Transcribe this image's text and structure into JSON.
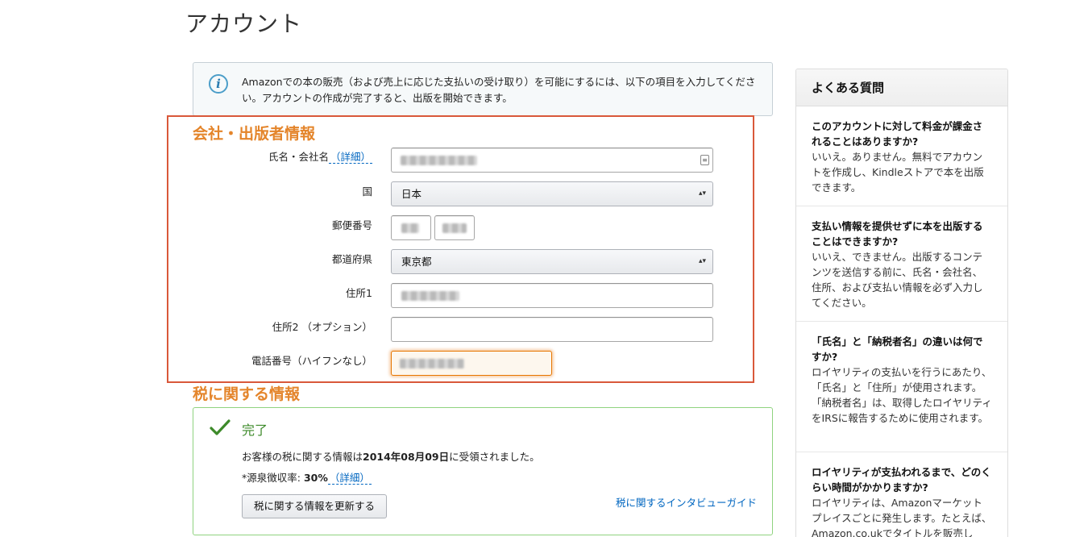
{
  "page": {
    "title": "アカウント"
  },
  "info": {
    "icon": "info-icon",
    "text": "Amazonでの本の販売（および売上に応じた支払いの受け取り）を可能にするには、以下の項目を入力してください。アカウントの作成が完了すると、出版を開始できます。"
  },
  "company_section": {
    "heading": "会社・出版者情報",
    "name_label": "氏名・会社名",
    "detail_link": "（詳細）",
    "country_label": "国",
    "country_value": "日本",
    "postal_label": "郵便番号",
    "prefecture_label": "都道府県",
    "prefecture_value": "東京都",
    "address1_label": "住所1",
    "address2_label": "住所2 （オプション）",
    "address2_value": "",
    "phone_label": "電話番号（ハイフンなし）"
  },
  "tax_section": {
    "heading": "税に関する情報",
    "status": "完了",
    "received_prefix": "お客様の税に関する情報は",
    "received_date": "2014年08月09日",
    "received_suffix": "に受領されました。",
    "withholding_label": "*源泉徴収率: ",
    "withholding_rate": "30%",
    "detail_link": "（詳細）",
    "update_button": "税に関する情報を更新する",
    "guide_link": "税に関するインタビューガイド"
  },
  "faq": {
    "title": "よくある質問",
    "items": [
      {
        "q": "このアカウントに対して料金が課金されることはありますか?",
        "a": "いいえ。ありません。無料でアカウントを作成し、Kindleストアで本を出版できます。"
      },
      {
        "q": "支払い情報を提供せずに本を出版することはできますか?",
        "a": "いいえ、できません。出版するコンテンツを送信する前に、氏名・会社名、住所、および支払い情報を必ず入力してください。"
      },
      {
        "q": "「氏名」と「納税者名」の違いは何ですか?",
        "a": "ロイヤリティの支払いを行うにあたり、「氏名」と「住所」が使用されます。「納税者名」は、取得したロイヤリティをIRSに報告するために使用されます。"
      },
      {
        "q": "ロイヤリティが支払われるまで、どのくらい時間がかかりますか?",
        "a": "ロイヤリティは、Amazonマーケットプレイスごとに発生します。たとえば、Amazon.co.ukでタイトルを販売し"
      }
    ]
  },
  "colors": {
    "section_heading": "#e4852b",
    "highlight_frame": "#d9583a",
    "success": "#3d8a2a",
    "link": "#0066c0"
  }
}
